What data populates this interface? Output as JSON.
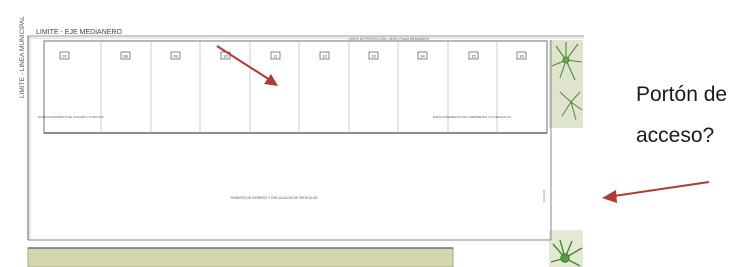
{
  "plan": {
    "title": "LIMITE - EJE MEDIANERO",
    "top_note": "LIMITE DE PROTECCIÓN - NIVEL PLAZA MEDIANERO",
    "side_label": "LIMITE - LINEA MUNICIPAL",
    "right_vertical_note": "ACCESO",
    "room_numbers": [
      "07",
      "08",
      "09",
      "10",
      "11",
      "12",
      "13",
      "14",
      "15",
      "16"
    ],
    "left_caption": "ESTACIONAMIENTO DE COCHES Y/O MOTOS",
    "right_caption": "ESTACIONAMIENTO DE CAMIONETAS Y/O VEHICULOS",
    "center_caption": "SENDERO DE INGRESO Y CIRCULACION DE VEHICULOS"
  },
  "annotation": {
    "line1": "Portón de",
    "line2": "acceso?"
  },
  "colors": {
    "arrow": "#b03a34",
    "line": "#8a8a8a",
    "landscape": "#dfe4cf",
    "bottom_band": "#d4d6b0",
    "plant": "#6aa84f"
  }
}
